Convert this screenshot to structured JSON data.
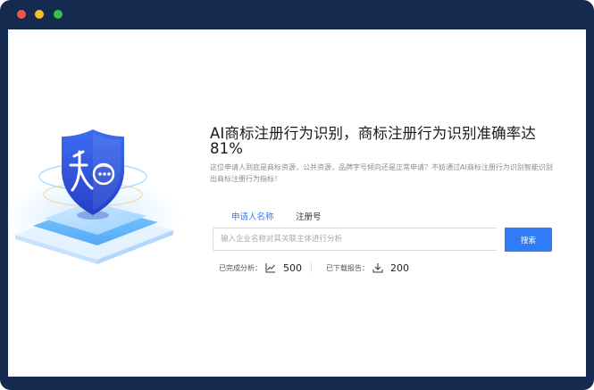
{
  "window": {
    "controls": [
      "close",
      "minimize",
      "maximize"
    ],
    "frame_color": "#152a4f"
  },
  "hero": {
    "title": "AI商标注册行为识别，商标注册行为识别准确率达81%",
    "description": "这位申请人到底是商标资源，公共资源，品牌字号倾向还是正常申请？不妨通过AI商标注册行为识别智能识别出商标注册行为指标！"
  },
  "tabs": [
    {
      "label": "申请人名称",
      "active": true
    },
    {
      "label": "注册号",
      "active": false
    }
  ],
  "search": {
    "placeholder": "输入企业名称对其关联主体进行分析",
    "value": "",
    "button_label": "搜索"
  },
  "stats": [
    {
      "label": "已完成分析：",
      "icon": "trend-chart-icon",
      "value": "500"
    },
    {
      "label": "已下载报告：",
      "icon": "download-icon",
      "value": "200"
    }
  ],
  "colors": {
    "accent": "#2f7cf6",
    "shield": "#2f54d6",
    "title_text": "#1a1a1a",
    "muted_text": "#8c8c8c"
  }
}
